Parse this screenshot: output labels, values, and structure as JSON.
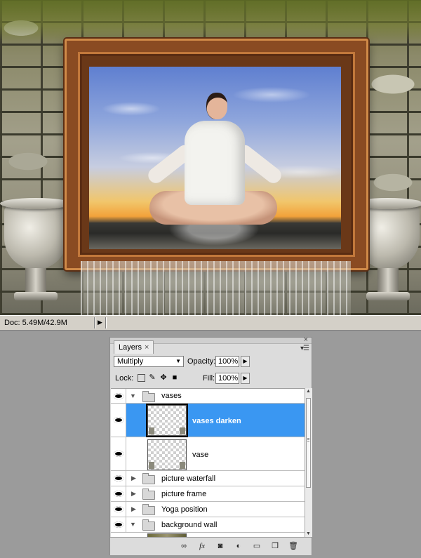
{
  "status_bar": {
    "doc": "Doc: 5.49M/42.9M",
    "arrow": "▶"
  },
  "layers_panel": {
    "tab_label": "Layers",
    "tab_close": "×",
    "panel_close": "×",
    "panel_menu": "▾☰",
    "blend_mode": "Multiply",
    "opacity_label": "Opacity:",
    "opacity_value": "100%",
    "lock_label": "Lock:",
    "fill_label": "Fill:",
    "fill_value": "100%",
    "layers": [
      {
        "name": "vases",
        "type": "group",
        "expanded": true
      },
      {
        "name": "vases darken",
        "type": "layer",
        "selected": true
      },
      {
        "name": "vase",
        "type": "layer",
        "selected": false
      },
      {
        "name": "picture waterfall",
        "type": "group",
        "expanded": false
      },
      {
        "name": "picture frame",
        "type": "group",
        "expanded": false
      },
      {
        "name": "Yoga position",
        "type": "group",
        "expanded": false
      },
      {
        "name": "background wall",
        "type": "group",
        "expanded": true
      }
    ],
    "bottom_icons": [
      "link-icon",
      "fx-icon",
      "mask-icon",
      "adjustment-icon",
      "new-group-icon",
      "new-layer-icon",
      "trash-icon"
    ],
    "selected_color": "#3a97f2"
  }
}
